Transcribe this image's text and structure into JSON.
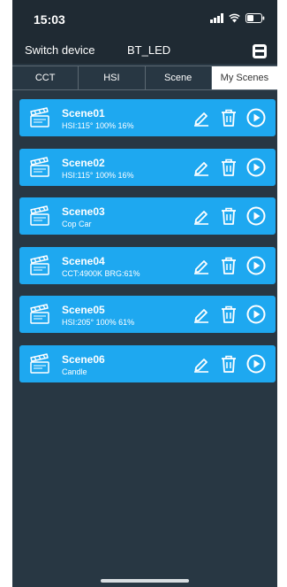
{
  "status_bar": {
    "time": "15:03",
    "icons": [
      "signal-icon",
      "wifi-icon",
      "battery-icon"
    ]
  },
  "header": {
    "switch_device_label": "Switch device",
    "device_name": "BT_LED",
    "save_icon": "save-icon"
  },
  "tabs": [
    {
      "label": "CCT",
      "active": false
    },
    {
      "label": "HSI",
      "active": false
    },
    {
      "label": "Scene",
      "active": false
    },
    {
      "label": "My Scenes",
      "active": true
    }
  ],
  "scenes": [
    {
      "name": "Scene01",
      "detail": "HSI:115° 100% 16%"
    },
    {
      "name": "Scene02",
      "detail": "HSI:115° 100% 16%"
    },
    {
      "name": "Scene03",
      "detail": "Cop Car"
    },
    {
      "name": "Scene04",
      "detail": "CCT:4900K BRG:61%"
    },
    {
      "name": "Scene05",
      "detail": "HSI:205° 100% 61%"
    },
    {
      "name": "Scene06",
      "detail": "Candle"
    }
  ],
  "scene_icons": [
    "clapperboard-icon",
    "edit-icon",
    "delete-icon",
    "play-icon"
  ],
  "colors": {
    "background": "#283743",
    "header": "#1f2a33",
    "scene_card": "#1ea8f0",
    "active_tab": "#ffffff"
  }
}
